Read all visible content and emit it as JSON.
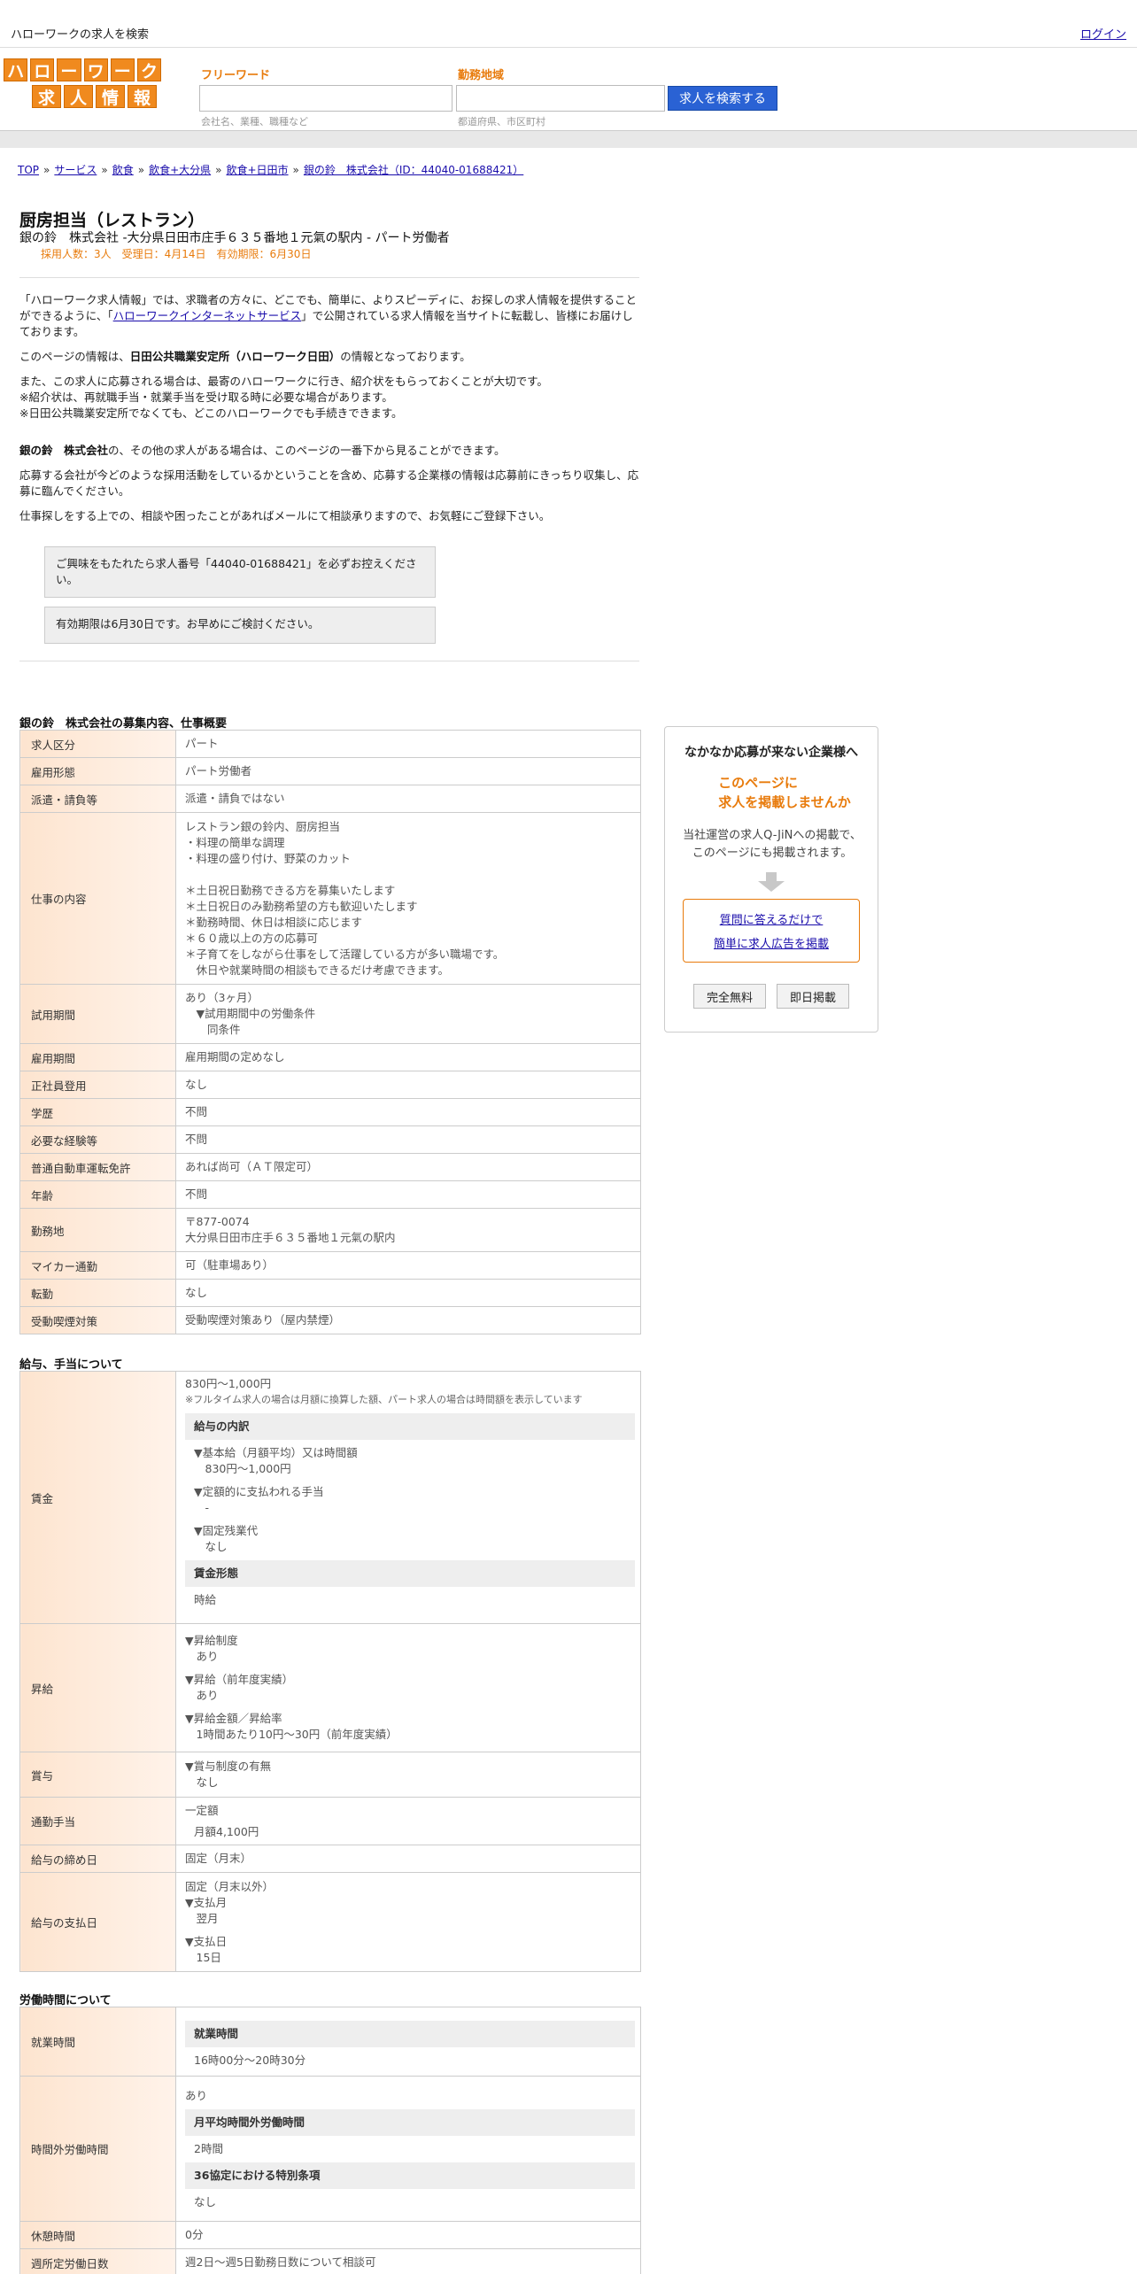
{
  "topbar": {
    "tagline": "ハローワークの求人を検索",
    "login": "ログイン"
  },
  "logo": {
    "row1": [
      "ハ",
      "ロ",
      "ー",
      "ワ",
      "ー",
      "ク"
    ],
    "row2": [
      "求",
      "人",
      "情",
      "報"
    ]
  },
  "search": {
    "keyword_label": "フリーワード",
    "area_label": "勤務地域",
    "keyword_placeholder": "",
    "area_placeholder": "",
    "keyword_hint": "会社名、業種、職種など",
    "area_hint": "都道府県、市区町村",
    "button": "求人を検索する"
  },
  "breadcrumb": [
    "TOP",
    "サービス",
    "飲食",
    "飲食+大分県",
    "飲食+日田市",
    "銀の鈴　株式会社（ID：44040-01688421）"
  ],
  "job": {
    "title": "厨房担当（レストラン）",
    "subtitle": "銀の鈴　株式会社 -大分県日田市庄手６３５番地１元氣の駅内 - パート労働者",
    "meta": "採用人数：3人　受理日：4月14日　有効期限：6月30日"
  },
  "intro": {
    "p1_a": "「ハローワーク求人情報」では、求職者の方々に、どこでも、簡単に、よりスピーディに、お探しの求人情報を提供することができるように、「",
    "p1_link": "ハローワークインターネットサービス",
    "p1_b": "」で公開されている求人情報を当サイトに転載し、皆様にお届けしております。",
    "p2_a": "このページの情報は、",
    "p2_bold": "日田公共職業安定所（ハローワーク日田）",
    "p2_b": "の情報となっております。",
    "p3_1": "また、この求人に応募される場合は、最寄のハローワークに行き、紹介状をもらっておくことが大切です。",
    "p3_2": "※紹介状は、再就職手当・就業手当を受け取る時に必要な場合があります。",
    "p3_3": "※日田公共職業安定所でなくても、どこのハローワークでも手続きできます。",
    "p4_bold": "銀の鈴　株式会社",
    "p4_rest": "の、その他の求人がある場合は、このページの一番下から見ることができます。",
    "p5": "応募する会社が今どのような採用活動をしているかということを含め、応募する企業様の情報は応募前にきっちり収集し、応募に臨んでください。",
    "p6": "仕事探しをする上での、相談や困ったことがあればメールにて相談承りますので、お気軽にご登録下さい。"
  },
  "notices": [
    "ご興味をもたれたら求人番号「44040-01688421」を必ずお控えください。",
    "有効期限は6月30日です。お早めにご検討ください。"
  ],
  "sections": {
    "overview": "銀の鈴　株式会社の募集内容、仕事概要",
    "salary": "給与、手当について",
    "hours": "労働時間について"
  },
  "overview": {
    "kyujin_kubun": {
      "label": "求人区分",
      "value": "パート"
    },
    "koyou_keitai": {
      "label": "雇用形態",
      "value": "パート労働者"
    },
    "haken": {
      "label": "派遣・請負等",
      "value": "派遣・請負ではない"
    },
    "shigoto": {
      "label": "仕事の内容",
      "value": "レストラン銀の鈴内、厨房担当\n・料理の簡単な調理\n・料理の盛り付け、野菜のカット\n\n＊土日祝日勤務できる方を募集いたします\n＊土日祝日のみ勤務希望の方も歓迎いたします\n＊勤務時間、休日は相談に応じます\n＊６０歳以上の方の応募可\n＊子育てをしながら仕事をして活躍している方が多い職場です。\n　休日や就業時間の相談もできるだけ考慮できます。"
    },
    "shiyou": {
      "label": "試用期間",
      "value": "あり（3ヶ月）\n　▼試用期間中の労働条件\n　　同条件"
    },
    "koyou_kikan": {
      "label": "雇用期間",
      "value": "雇用期間の定めなし"
    },
    "seishain": {
      "label": "正社員登用",
      "value": "なし"
    },
    "gakureki": {
      "label": "学歴",
      "value": "不問"
    },
    "keiken": {
      "label": "必要な経験等",
      "value": "不問"
    },
    "menkyo": {
      "label": "普通自動車運転免許",
      "value": "あれば尚可（ＡＴ限定可）"
    },
    "nenrei": {
      "label": "年齢",
      "value": "不問"
    },
    "kinmuchi": {
      "label": "勤務地",
      "value": "〒877-0074\n大分県日田市庄手６３５番地１元氣の駅内"
    },
    "mycar": {
      "label": "マイカー通勤",
      "value": "可（駐車場あり）"
    },
    "tenkin": {
      "label": "転勤",
      "value": "なし"
    },
    "kitsuen": {
      "label": "受動喫煙対策",
      "value": "受動喫煙対策あり（屋内禁煙）"
    }
  },
  "salary": {
    "chingin": {
      "label": "賃金",
      "range": "830円〜1,000円",
      "note": "※フルタイム求人の場合は月額に換算した額、パート求人の場合は時間額を表示しています",
      "breakdown_head": "給与の内訳",
      "kihon": "▼基本給（月額平均）又は時間額\n　830円〜1,000円",
      "teigaku": "▼定額的に支払われる手当\n　-",
      "kotei": "▼固定残業代\n　なし",
      "keitai_head": "賃金形態",
      "keitai": "時給"
    },
    "shokyu": {
      "label": "昇給",
      "v1": "▼昇給制度\n　あり",
      "v2": "▼昇給（前年度実績）\n　あり",
      "v3": "▼昇給金額／昇給率\n　1時間あたり10円〜30円（前年度実績）"
    },
    "shoyo": {
      "label": "賞与",
      "value": "▼賞与制度の有無\n　なし"
    },
    "tsukin": {
      "label": "通勤手当",
      "value": "一定額",
      "sub": "月額4,100円"
    },
    "shime": {
      "label": "給与の締め日",
      "value": "固定（月末）"
    },
    "shiharai": {
      "label": "給与の支払日",
      "v1": "固定（月末以外）\n▼支払月\n　翌月",
      "v2": "▼支払日\n　15日"
    }
  },
  "hours": {
    "shugyo": {
      "label": "就業時間",
      "head": "就業時間",
      "value": "16時00分〜20時30分"
    },
    "jikangai": {
      "label": "時間外労働時間",
      "value": "あり",
      "head1": "月平均時間外労働時間",
      "v1": "2時間",
      "head2": "36協定における特別条項",
      "v2": "なし"
    },
    "kyukei": {
      "label": "休憩時間",
      "value": "0分"
    },
    "nissu": {
      "label": "週所定労働日数",
      "value": "週2日〜週5日勤務日数について相談可"
    }
  },
  "side": {
    "title": "なかなか応募が来ない企業様へ",
    "headline1": "このページに",
    "headline2": "求人を掲載しませんか",
    "desc": "当社運営の求人Q-JiNへの掲載で、このページにも掲載されます。",
    "link1": "質問に答えるだけで",
    "link2": "簡単に求人広告を掲載",
    "btn_free": "完全無料",
    "btn_same_day": "即日掲載"
  },
  "colors": {
    "accent_orange": "#e87b0c",
    "search_blue": "#2a62d4",
    "logo_orange": "#f08a1e"
  }
}
